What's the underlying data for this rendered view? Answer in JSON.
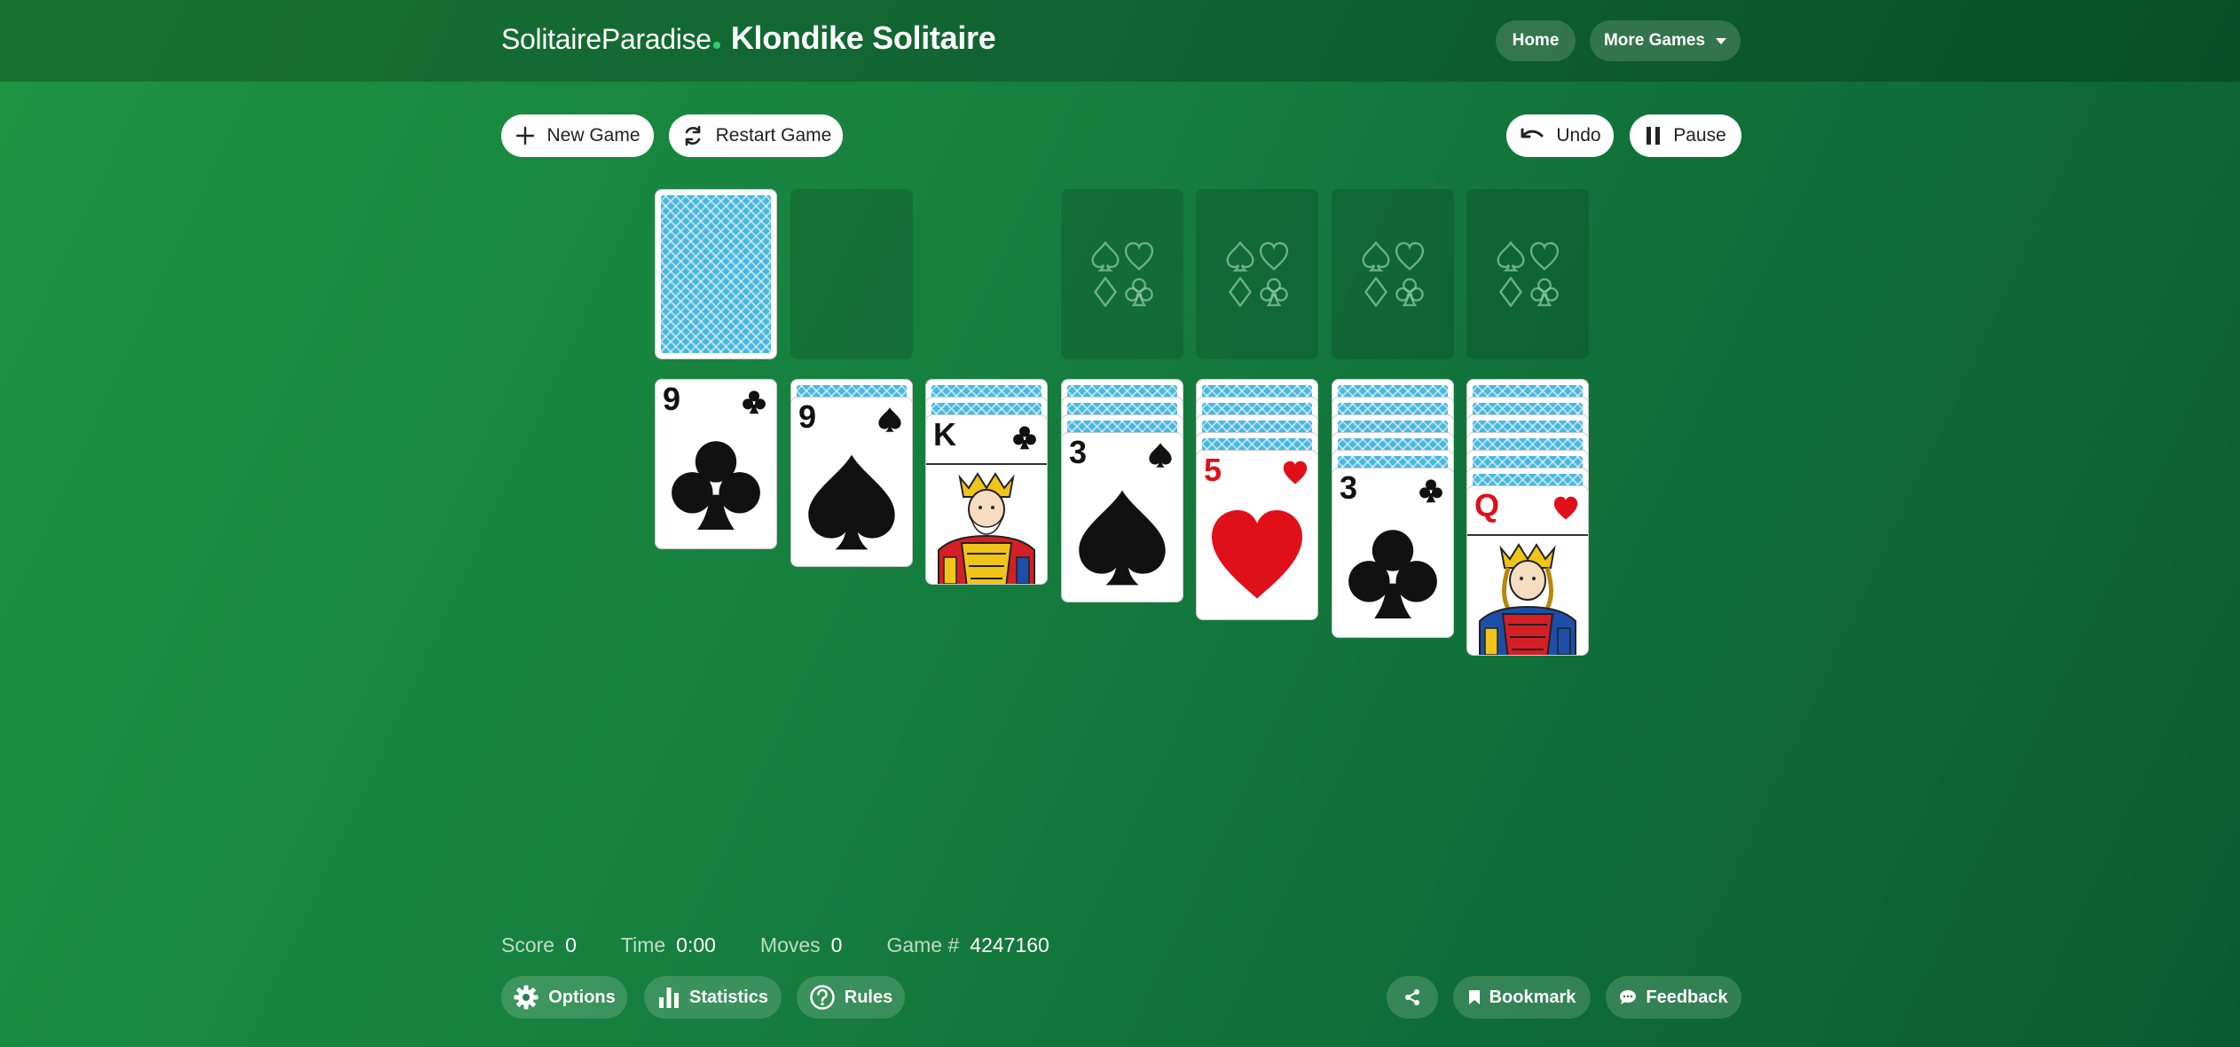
{
  "header": {
    "site_name": "SolitaireParadise",
    "game_title": "Klondike Solitaire",
    "home_label": "Home",
    "more_games_label": "More Games"
  },
  "toolbar": {
    "new_game_label": "New Game",
    "restart_label": "Restart Game",
    "undo_label": "Undo",
    "pause_label": "Pause"
  },
  "tableau": [
    {
      "face_down": 0,
      "rank": "9",
      "suit": "clubs",
      "color": "black",
      "face_card": false
    },
    {
      "face_down": 1,
      "rank": "9",
      "suit": "spades",
      "color": "black",
      "face_card": false
    },
    {
      "face_down": 2,
      "rank": "K",
      "suit": "clubs",
      "color": "black",
      "face_card": true
    },
    {
      "face_down": 3,
      "rank": "3",
      "suit": "spades",
      "color": "black",
      "face_card": false
    },
    {
      "face_down": 4,
      "rank": "5",
      "suit": "hearts",
      "color": "red",
      "face_card": false
    },
    {
      "face_down": 5,
      "rank": "3",
      "suit": "clubs",
      "color": "black",
      "face_card": false
    },
    {
      "face_down": 6,
      "rank": "Q",
      "suit": "hearts",
      "color": "red",
      "face_card": true
    }
  ],
  "stats": {
    "score_label": "Score",
    "score": "0",
    "time_label": "Time",
    "time": "0:00",
    "moves_label": "Moves",
    "moves": "0",
    "game_label": "Game #",
    "game_number": "4247160"
  },
  "footer": {
    "options_label": "Options",
    "statistics_label": "Statistics",
    "rules_label": "Rules",
    "bookmark_label": "Bookmark",
    "feedback_label": "Feedback"
  },
  "colors": {
    "accent_dot": "#2ecc71",
    "card_back": "#49b8e0",
    "red_suit": "#e0101a",
    "felt": "#16803f"
  }
}
